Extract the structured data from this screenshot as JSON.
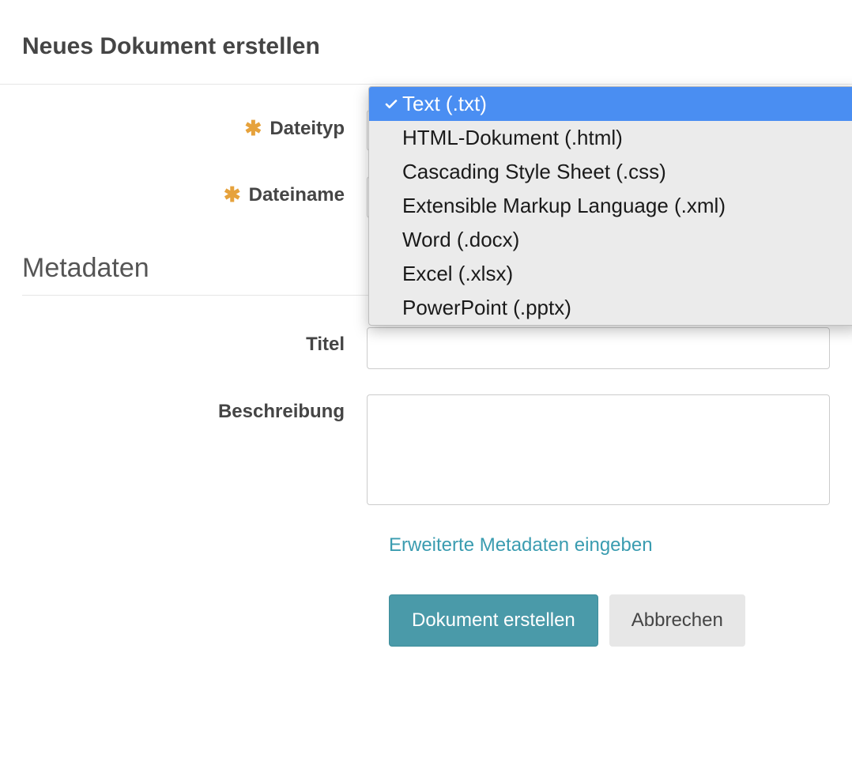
{
  "dialog": {
    "title": "Neues Dokument erstellen"
  },
  "form": {
    "filetype": {
      "label": "Dateityp",
      "required_marker": "✱",
      "selected": "Text (.txt)",
      "options": [
        "Text (.txt)",
        "HTML-Dokument (.html)",
        "Cascading Style Sheet (.css)",
        "Extensible Markup Language (.xml)",
        "Word (.docx)",
        "Excel (.xlsx)",
        "PowerPoint (.pptx)"
      ]
    },
    "filename": {
      "label": "Dateiname",
      "required_marker": "✱",
      "value": ""
    }
  },
  "metadata": {
    "heading": "Metadaten",
    "title_field": {
      "label": "Titel",
      "value": ""
    },
    "description_field": {
      "label": "Beschreibung",
      "value": ""
    },
    "advanced_link": "Erweiterte Metadaten eingeben"
  },
  "buttons": {
    "create": "Dokument erstellen",
    "cancel": "Abbrechen"
  },
  "colors": {
    "accent_teal": "#4a9aa9",
    "required_orange": "#e6a23c",
    "dropdown_highlight": "#4a8ef2"
  }
}
